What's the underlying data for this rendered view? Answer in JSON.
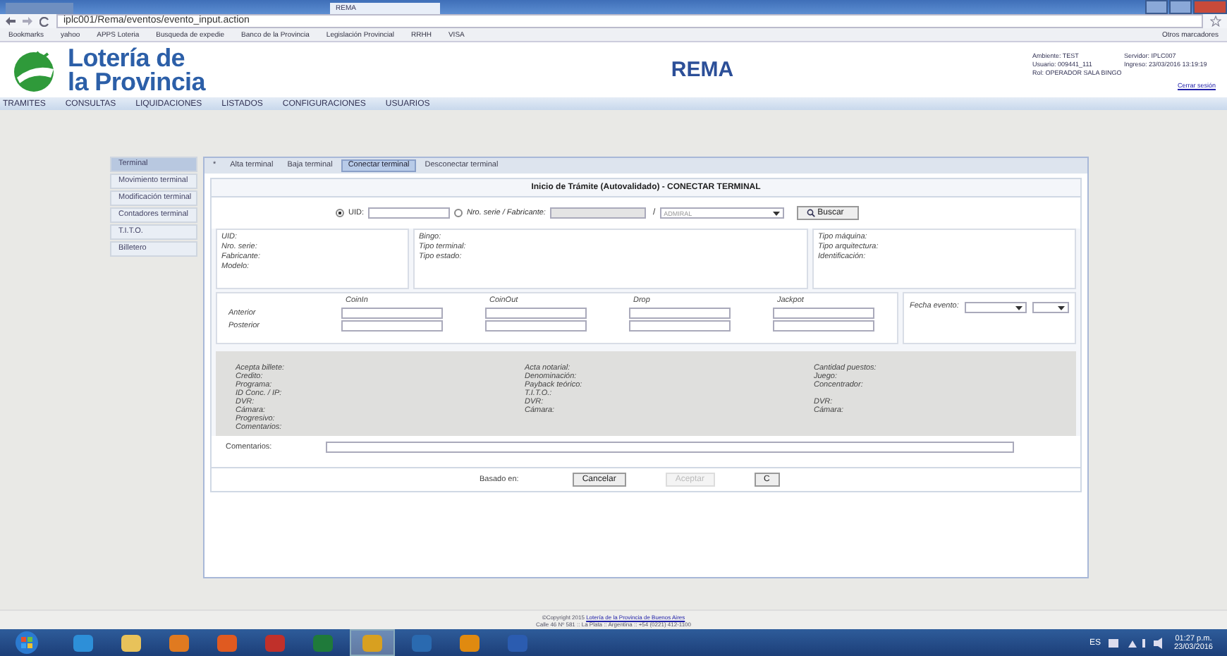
{
  "browser": {
    "tabs": [
      {
        "selected": false
      },
      {
        "label": "REMA",
        "selected": true
      }
    ],
    "address": "iplc001/Rema/eventos/evento_input.action",
    "bookmarks": [
      "Bookmarks",
      "yahoo",
      "APPS Loteria",
      "Busqueda de expedie",
      "Banco de la Provincia",
      "Legislación Provincial",
      "RRHH",
      "VISA"
    ],
    "other_bookmarks": "Otros marcadores"
  },
  "header": {
    "logo_lines": [
      "Lotería de",
      "la Provincia"
    ],
    "title": "REMA",
    "session": [
      "Ambiente: TEST",
      "Servidor: IPLC007",
      "Usuario: 009441_111",
      "Ingreso: 23/03/2016 13:19:19",
      "Rol: OPERADOR SALA BINGO"
    ],
    "logout": "Cerrar sesión"
  },
  "menu": [
    "TRAMITES",
    "CONSULTAS",
    "LIQUIDACIONES",
    "LISTADOS",
    "CONFIGURACIONES",
    "USUARIOS"
  ],
  "sidebar": {
    "items": [
      {
        "label": "Terminal",
        "selected": true
      },
      {
        "label": "Movimiento terminal",
        "selected": false
      },
      {
        "label": "Modificación terminal",
        "selected": false
      },
      {
        "label": "Contadores terminal",
        "selected": false
      },
      {
        "label": "T.I.T.O.",
        "selected": false
      },
      {
        "label": "Billetero",
        "selected": false
      }
    ]
  },
  "tabs": [
    {
      "label": "*",
      "selected": false
    },
    {
      "label": "Alta terminal",
      "selected": false
    },
    {
      "label": "Baja terminal",
      "selected": false
    },
    {
      "label": "Conectar terminal",
      "selected": true
    },
    {
      "label": "Desconectar terminal",
      "selected": false
    }
  ],
  "form": {
    "title": "Inicio de Trámite (Autovalidado) - CONECTAR TERMINAL",
    "search_options": [
      {
        "label": "UID:",
        "selected": true,
        "disabled": false
      },
      {
        "label": "Nro. serie / Fabricante:",
        "selected": false,
        "disabled": true
      }
    ],
    "separator": "/",
    "manufacturer": "ADMIRAL",
    "search_button": "Buscar",
    "info_columns": [
      [
        "UID:",
        "Nro. serie:",
        "Fabricante:",
        "Modelo:"
      ],
      [
        "Bingo:",
        "Tipo terminal:",
        "Tipo estado:"
      ],
      [
        "Tipo máquina:",
        "Tipo arquitectura:",
        "Identificación:"
      ]
    ],
    "counters": {
      "columns": [
        "CoinIn",
        "CoinOut",
        "Drop",
        "Jackpot"
      ],
      "rows": [
        "Anterior",
        "Posterior"
      ]
    },
    "event_date_label": "Fecha evento:",
    "detail_columns": [
      [
        "Acepta billete:",
        "Credito:",
        "Programa:",
        "ID Conc. / IP:",
        "DVR:",
        "Cámara:",
        "Progresivo:",
        "Comentarios:"
      ],
      [
        "Acta notarial:",
        "Denominación:",
        "Payback teórico:",
        "T.I.T.O.:",
        "DVR:",
        "Cámara:"
      ],
      [
        "Cantidad puestos:",
        "Juego:",
        "Concentrador:",
        "",
        "DVR:",
        "Cámara:"
      ]
    ],
    "comments_label": "Comentarios:",
    "based_on": "Basado en:",
    "buttons": [
      {
        "label": "Cancelar",
        "disabled": false
      },
      {
        "label": "Aceptar",
        "disabled": true
      },
      {
        "label": "C",
        "disabled": false
      }
    ]
  },
  "footer": {
    "copyright": "©Copyright 2015",
    "link": "Lotería de la Provincia de Buenos Aires",
    "address": "Calle 46 Nº 581 :: La Plata :: Argentina :: +54 (0221) 412-1100"
  },
  "taskbar": {
    "apps": [
      {
        "kind": "ie",
        "selected": false
      },
      {
        "kind": "folder",
        "selected": false
      },
      {
        "kind": "media",
        "selected": false
      },
      {
        "kind": "firefox",
        "selected": false
      },
      {
        "kind": "app",
        "selected": false
      },
      {
        "kind": "excel",
        "selected": false
      },
      {
        "kind": "chrome",
        "selected": true
      },
      {
        "kind": "lync",
        "selected": false
      },
      {
        "kind": "outlook",
        "selected": false
      },
      {
        "kind": "word",
        "selected": false
      }
    ],
    "language": "ES",
    "time": "01:27 p.m.",
    "date": "23/03/2016"
  }
}
